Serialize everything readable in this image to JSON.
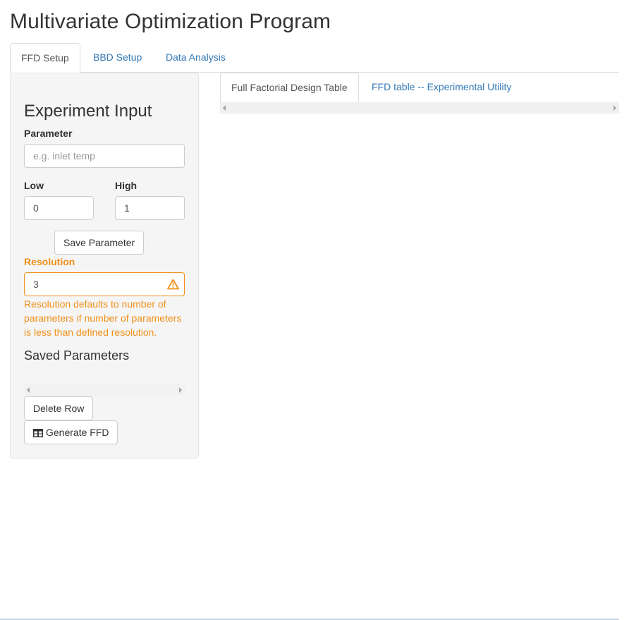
{
  "page": {
    "title": "Multivariate Optimization Program"
  },
  "top_tabs": [
    {
      "label": "FFD Setup",
      "active": true
    },
    {
      "label": "BBD Setup",
      "active": false
    },
    {
      "label": "Data Analysis",
      "active": false
    }
  ],
  "sidebar": {
    "heading": "Experiment Input",
    "parameter": {
      "label": "Parameter",
      "value": "",
      "placeholder": "e.g. inlet temp"
    },
    "low": {
      "label": "Low",
      "value": "0"
    },
    "high": {
      "label": "High",
      "value": "1"
    },
    "save_button": "Save Parameter",
    "resolution": {
      "label": "Resolution",
      "value": "3",
      "help_text": "Resolution defaults to number of parameters if number of parameters is less than defined resolution."
    },
    "saved_heading": "Saved Parameters",
    "delete_button": "Delete Row",
    "generate_button": "Generate FFD"
  },
  "main_tabs": [
    {
      "label": "Full Factorial Design Table",
      "active": true
    },
    {
      "label": "FFD table -- Experimental Utility",
      "active": false
    }
  ],
  "colors": {
    "link": "#337ab7",
    "warning": "#f0901a",
    "well_background": "#f5f5f5"
  },
  "icons": {
    "warning": "warning-icon",
    "generate": "table-icon"
  }
}
